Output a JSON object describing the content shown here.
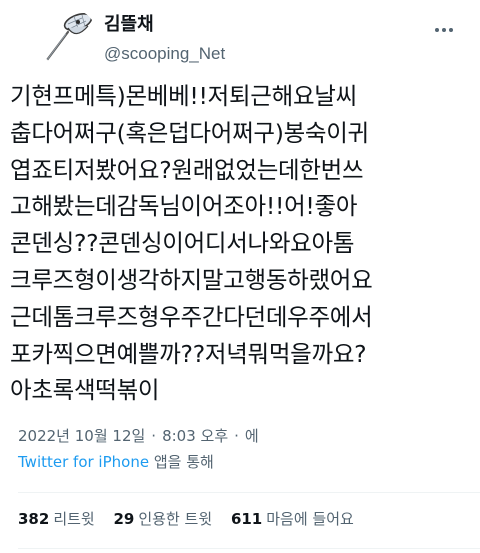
{
  "author": {
    "display_name": "김뜰채",
    "handle": "@scooping_Net",
    "avatar_icon": "scoop-net-avatar-icon"
  },
  "more_icon": "more-options-icon",
  "tweet": {
    "lines": [
      "기현프메특)몬베베!!저퇴근해요날씨",
      "춥다어쩌구(혹은덥다어쩌구)봉숙이귀",
      "엽죠티저봤어요?원래없었는데한번쓰",
      "고해봤는데감독님이어조아!!어!좋아",
      "콘덴싱??콘덴싱이어디서나와요아톰",
      "크루즈형이생각하지말고행동하랬어요",
      "근데톰크루즈형우주간다던데우주에서",
      "포카찍으면예쁠까??저녁뭐먹을까요?",
      "아초록색떡볶이"
    ]
  },
  "meta": {
    "date": "2022년 10월 12일",
    "separator": "·",
    "time": "8:03 오후",
    "separator2": "·",
    "suffix": "에"
  },
  "source": {
    "app_name": "Twitter for iPhone",
    "suffix": " 앱을 통해"
  },
  "stats": {
    "retweets": {
      "count": "382",
      "label": "리트윗"
    },
    "quotes": {
      "count": "29",
      "label": "인용한 트윗"
    },
    "likes": {
      "count": "611",
      "label": "마음에 들어요"
    }
  },
  "colors": {
    "text": "#0f1419",
    "secondary": "#536471",
    "link": "#1d9bf0",
    "divider": "#eff3f4"
  }
}
